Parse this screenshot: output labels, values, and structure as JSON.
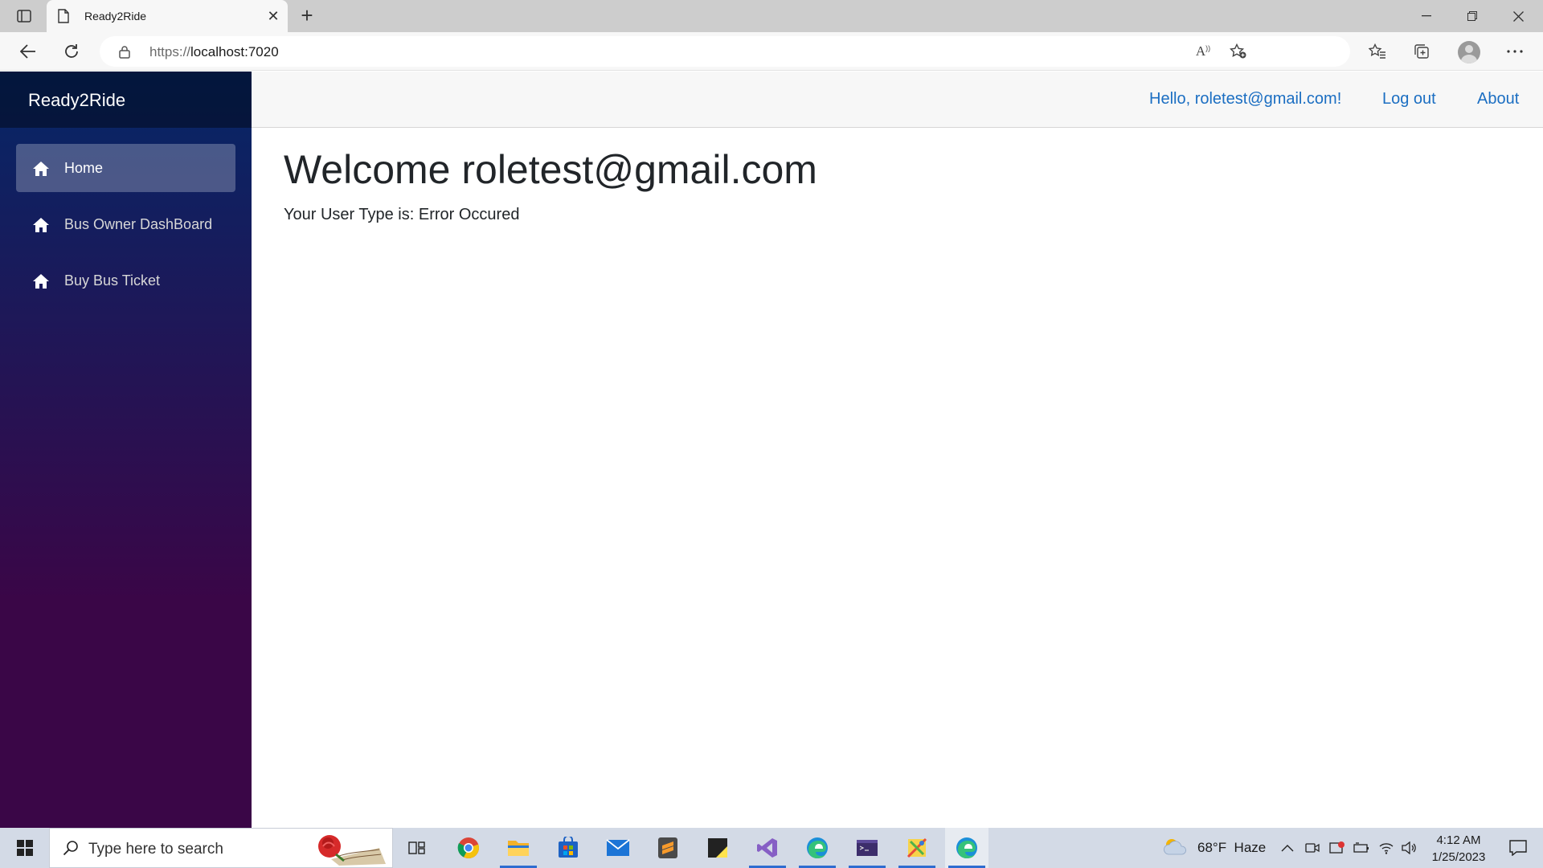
{
  "browser": {
    "tab_title": "Ready2Ride",
    "tab_close": "✕",
    "new_tab": "+",
    "url_scheme": "https://",
    "url_host": "localhost:7020",
    "read_aloud_label": "A",
    "icons": [
      "tab-actions-icon",
      "document-icon",
      "back-arrow-icon",
      "refresh-icon",
      "lock-icon",
      "read-aloud-icon",
      "add-favorite-icon",
      "favorites-icon",
      "collections-icon",
      "profile-avatar",
      "more-icon",
      "minimize-icon",
      "restore-icon",
      "close-icon"
    ]
  },
  "app": {
    "brand": "Ready2Ride",
    "nav": [
      {
        "label": "Home",
        "icon": "home-icon",
        "active": true
      },
      {
        "label": "Bus Owner DashBoard",
        "icon": "home-icon",
        "active": false
      },
      {
        "label": "Buy Bus Ticket",
        "icon": "home-icon",
        "active": false
      }
    ],
    "top_links": {
      "hello": "Hello, roletest@gmail.com!",
      "logout": "Log out",
      "about": "About"
    },
    "main": {
      "title": "Welcome roletest@gmail.com",
      "user_type": "Your User Type is: Error Occured"
    },
    "colors": {
      "sidebar_top": "#052767",
      "sidebar_bottom": "#3a0647",
      "link": "#1b6ec2"
    }
  },
  "taskbar": {
    "search_placeholder": "Type here to search",
    "weather": "68°F  Haze",
    "time": "4:12 AM",
    "date": "1/25/2023",
    "apps": [
      "task-view-icon",
      "chrome-icon",
      "file-explorer-icon",
      "microsoft-store-icon",
      "mail-icon",
      "sublime-text-icon",
      "sticky-notes-icon",
      "visual-studio-icon",
      "edge-icon",
      "terminal-icon",
      "paint-icon",
      "edge-icon"
    ]
  }
}
